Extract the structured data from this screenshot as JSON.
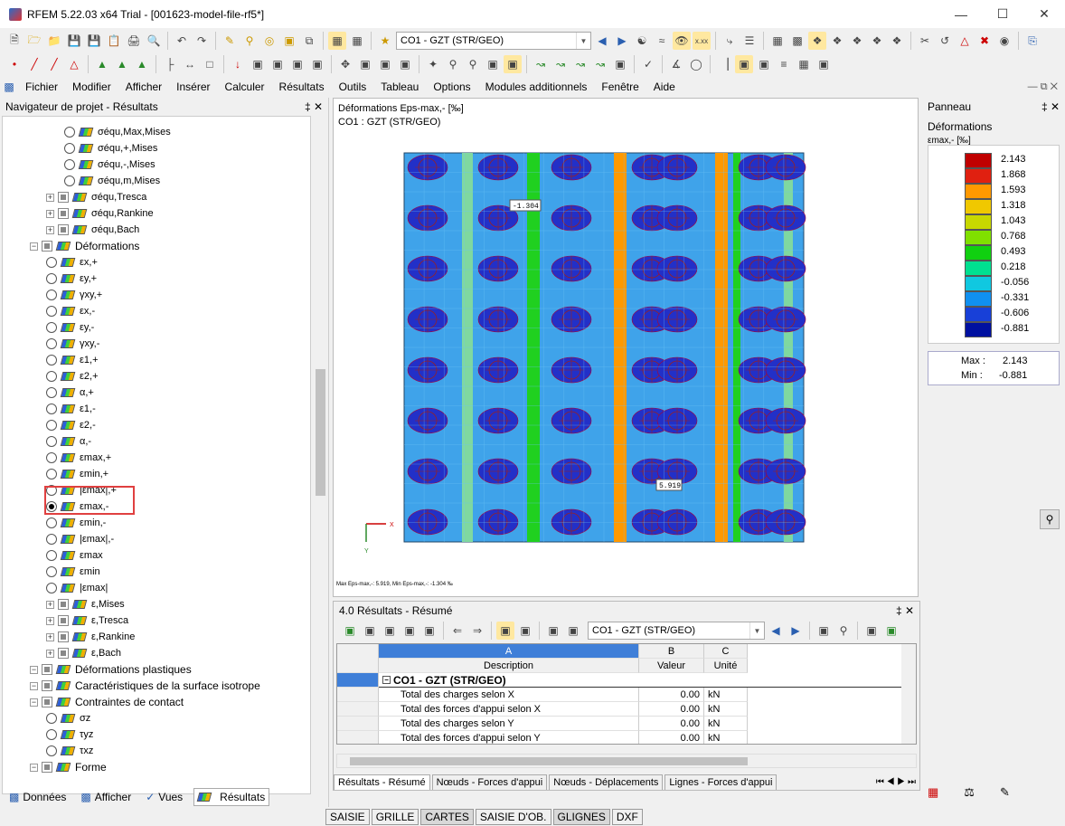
{
  "window": {
    "title": "RFEM 5.22.03 x64 Trial - [001623-model-file-rf5*]"
  },
  "toolbar": {
    "load_case": "CO1 - GZT (STR/GEO)"
  },
  "menu": [
    "Fichier",
    "Modifier",
    "Afficher",
    "Insérer",
    "Calculer",
    "Résultats",
    "Outils",
    "Tableau",
    "Options",
    "Modules additionnels",
    "Fenêtre",
    "Aide"
  ],
  "navigator": {
    "title": "Navigateur de projet - Résultats",
    "items": [
      {
        "label": "σéqu,Max,Mises",
        "kind": "radio",
        "level": 3
      },
      {
        "label": "σéqu,+,Mises",
        "kind": "radio",
        "level": 3
      },
      {
        "label": "σéqu,-,Mises",
        "kind": "radio",
        "level": 3
      },
      {
        "label": "σéqu,m,Mises",
        "kind": "radio",
        "level": 3
      },
      {
        "label": "σéqu,Tresca",
        "kind": "check",
        "level": 2
      },
      {
        "label": "σéqu,Rankine",
        "kind": "check",
        "level": 2
      },
      {
        "label": "σéqu,Bach",
        "kind": "check",
        "level": 2
      },
      {
        "label": "Déformations",
        "kind": "check",
        "level": 1,
        "big": true
      },
      {
        "label": "εx,+",
        "kind": "radio",
        "level": 2
      },
      {
        "label": "εy,+",
        "kind": "radio",
        "level": 2
      },
      {
        "label": "γxy,+",
        "kind": "radio",
        "level": 2
      },
      {
        "label": "εx,-",
        "kind": "radio",
        "level": 2
      },
      {
        "label": "εy,-",
        "kind": "radio",
        "level": 2
      },
      {
        "label": "γxy,-",
        "kind": "radio",
        "level": 2
      },
      {
        "label": "ε1,+",
        "kind": "radio",
        "level": 2
      },
      {
        "label": "ε2,+",
        "kind": "radio",
        "level": 2
      },
      {
        "label": "α,+",
        "kind": "radio",
        "level": 2
      },
      {
        "label": "ε1,-",
        "kind": "radio",
        "level": 2
      },
      {
        "label": "ε2,-",
        "kind": "radio",
        "level": 2
      },
      {
        "label": "α,-",
        "kind": "radio",
        "level": 2
      },
      {
        "label": "εmax,+",
        "kind": "radio",
        "level": 2
      },
      {
        "label": "εmin,+",
        "kind": "radio",
        "level": 2
      },
      {
        "label": "|εmax|,+",
        "kind": "radio",
        "level": 2
      },
      {
        "label": "εmax,-",
        "kind": "radio",
        "level": 2,
        "selected": true
      },
      {
        "label": "εmin,-",
        "kind": "radio",
        "level": 2
      },
      {
        "label": "|εmax|,-",
        "kind": "radio",
        "level": 2
      },
      {
        "label": "εmax",
        "kind": "radio",
        "level": 2
      },
      {
        "label": "εmin",
        "kind": "radio",
        "level": 2
      },
      {
        "label": "|εmax|",
        "kind": "radio",
        "level": 2
      },
      {
        "label": "ε,Mises",
        "kind": "check",
        "level": 2
      },
      {
        "label": "ε,Tresca",
        "kind": "check",
        "level": 2
      },
      {
        "label": "ε,Rankine",
        "kind": "check",
        "level": 2
      },
      {
        "label": "ε,Bach",
        "kind": "check",
        "level": 2
      },
      {
        "label": "Déformations plastiques",
        "kind": "check",
        "level": 1,
        "big": true
      },
      {
        "label": "Caractéristiques de la surface isotrope",
        "kind": "check",
        "level": 1,
        "big": true
      },
      {
        "label": "Contraintes de contact",
        "kind": "check",
        "level": 1,
        "big": true
      },
      {
        "label": "σz",
        "kind": "radio",
        "level": 2
      },
      {
        "label": "τyz",
        "kind": "radio",
        "level": 2
      },
      {
        "label": "τxz",
        "kind": "radio",
        "level": 2
      },
      {
        "label": "Forme",
        "kind": "check",
        "level": 1,
        "big": true
      }
    ],
    "tabs": [
      "Données",
      "Afficher",
      "Vues",
      "Résultats"
    ]
  },
  "viewport": {
    "title": "Déformations Eps-max,- [‰]",
    "subtitle": "CO1 : GZT (STR/GEO)",
    "footer": "Max Eps-max,-: 5.919, Min Eps-max,-: -1.304 ‰",
    "label_min": "-1.304",
    "label_max": "5.919",
    "axis_x": "X",
    "axis_y": "Y"
  },
  "panel": {
    "title": "Panneau",
    "heading": "Déformations",
    "unit": "εmax,- [‰]",
    "legend": [
      {
        "value": "2.143",
        "color": "#c00000"
      },
      {
        "value": "1.868",
        "color": "#e02010"
      },
      {
        "value": "1.593",
        "color": "#ff9900"
      },
      {
        "value": "1.318",
        "color": "#f0c800"
      },
      {
        "value": "1.043",
        "color": "#c8d800"
      },
      {
        "value": "0.768",
        "color": "#80e000"
      },
      {
        "value": "0.493",
        "color": "#10d010"
      },
      {
        "value": "0.218",
        "color": "#00e090"
      },
      {
        "value": "-0.056",
        "color": "#10c8e0"
      },
      {
        "value": "-0.331",
        "color": "#1090f0"
      },
      {
        "value": "-0.606",
        "color": "#1840d8"
      },
      {
        "value": "-0.881",
        "color": "#0010a0"
      }
    ],
    "max_label": "Max :",
    "max_value": "2.143",
    "min_label": "Min :",
    "min_value": "-0.881"
  },
  "results": {
    "title": "4.0 Résultats - Résumé",
    "load_case": "CO1 - GZT (STR/GEO)",
    "col_letters": [
      "A",
      "B",
      "C"
    ],
    "col_headers": [
      "Description",
      "Valeur",
      "Unité"
    ],
    "group": "CO1 - GZT (STR/GEO)",
    "rows": [
      {
        "desc": "Total des charges selon X",
        "value": "0.00",
        "unit": "kN"
      },
      {
        "desc": "Total des forces d'appui selon X",
        "value": "0.00",
        "unit": "kN"
      },
      {
        "desc": "Total des charges selon Y",
        "value": "0.00",
        "unit": "kN"
      },
      {
        "desc": "Total des forces d'appui selon Y",
        "value": "0.00",
        "unit": "kN"
      }
    ],
    "tabs": [
      "Résultats - Résumé",
      "Nœuds - Forces d'appui",
      "Nœuds - Déplacements",
      "Lignes - Forces d'appui"
    ]
  },
  "status": [
    "SAISIE",
    "GRILLE",
    "CARTES",
    "SAISIE D'OB.",
    "GLIGNES",
    "DXF"
  ]
}
